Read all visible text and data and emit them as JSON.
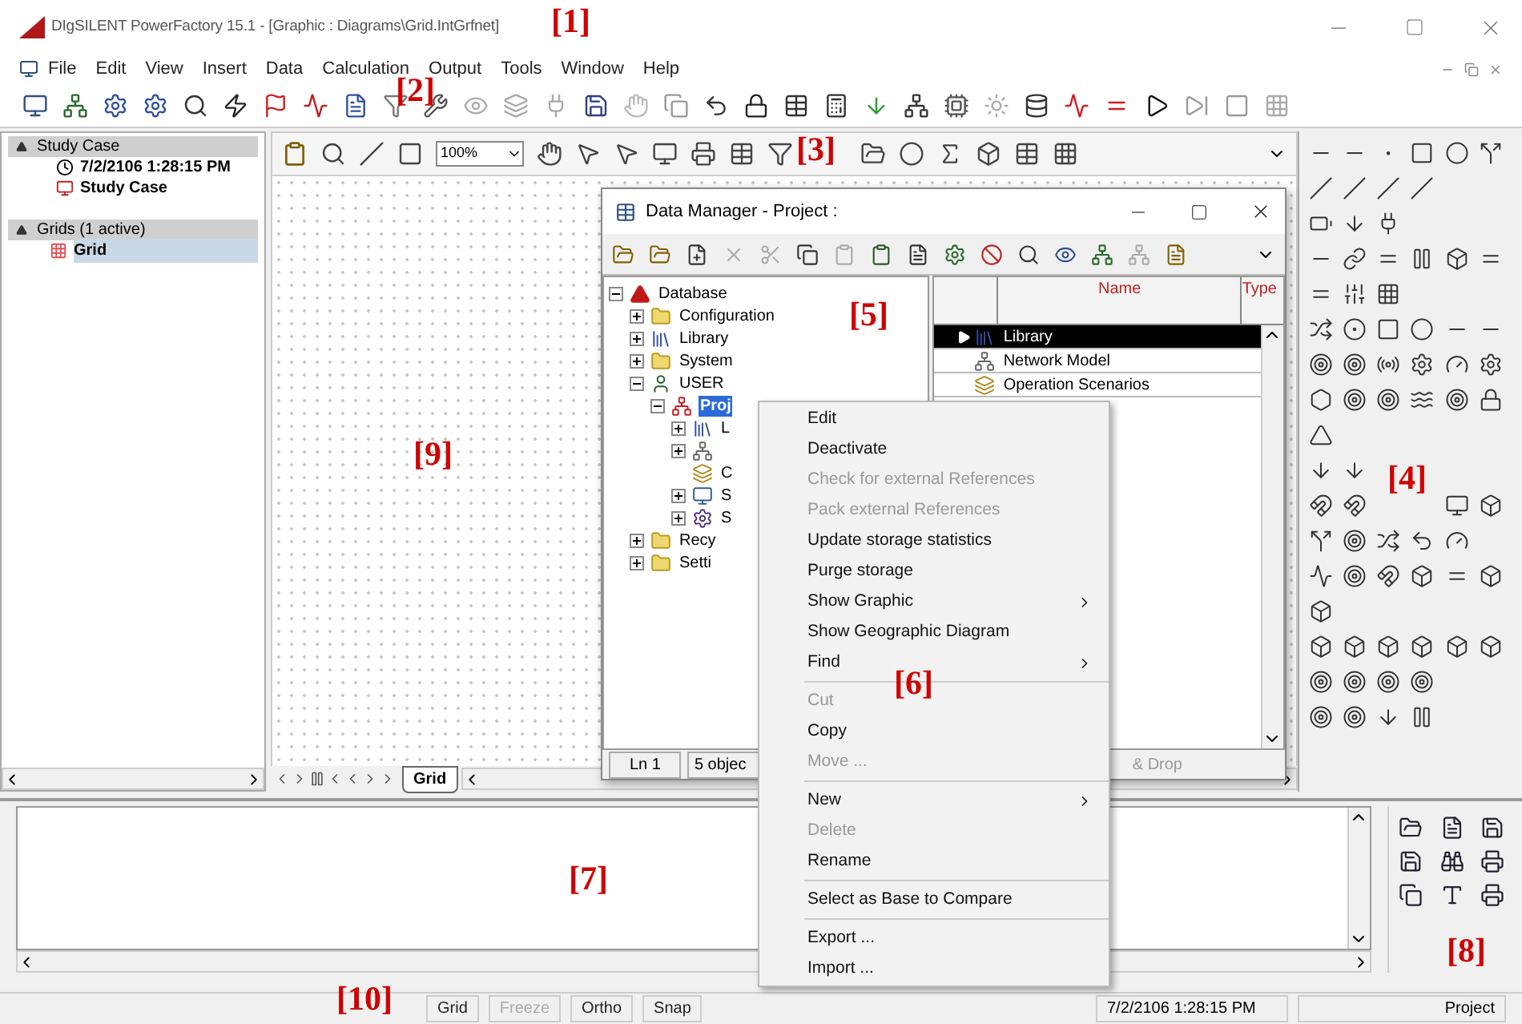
{
  "window": {
    "title": "DIgSILENT PowerFactory 15.1 - [Graphic : Diagrams\\Grid.IntGrfnet]"
  },
  "menu_bar": [
    "File",
    "Edit",
    "View",
    "Insert",
    "Data",
    "Calculation",
    "Output",
    "Tools",
    "Window",
    "Help"
  ],
  "study_case": {
    "header": "Study Case",
    "date": "7/2/2106 1:28:15 PM",
    "name": "Study Case"
  },
  "grids": {
    "header": "Grids (1 active)",
    "items": [
      {
        "label": "Grid",
        "selected": true
      }
    ]
  },
  "graphic": {
    "zoom": "100%",
    "tabs": [
      {
        "label": "Grid",
        "selected": true
      }
    ]
  },
  "data_manager": {
    "title": "Data Manager - Project :",
    "tree": [
      {
        "label": "Database",
        "kind": "database",
        "expanded": true,
        "selected": false,
        "children": [
          {
            "label": "Configuration",
            "kind": "folder",
            "expanded": false,
            "selected": false
          },
          {
            "label": "Library",
            "kind": "library",
            "expanded": false,
            "selected": false
          },
          {
            "label": "System",
            "kind": "folder",
            "expanded": false,
            "selected": false
          },
          {
            "label": "USER",
            "kind": "user",
            "expanded": true,
            "selected": false,
            "children": [
              {
                "label": "Proj",
                "kind": "project",
                "expanded": true,
                "selected": true,
                "children": [
                  {
                    "label": "L",
                    "kind": "library",
                    "expanded": false
                  },
                  {
                    "kind": "network",
                    "expanded": false
                  },
                  {
                    "label": "C",
                    "kind": "scenario"
                  },
                  {
                    "label": "S",
                    "kind": "study",
                    "expanded": false
                  },
                  {
                    "label": "S",
                    "kind": "settings",
                    "expanded": false
                  }
                ]
              }
            ]
          },
          {
            "label": "Recy",
            "kind": "folder",
            "expanded": false,
            "selected": false
          },
          {
            "label": "Setti",
            "kind": "folder",
            "expanded": false,
            "selected": false
          }
        ]
      }
    ],
    "columns": [
      "Name",
      "Type"
    ],
    "rows": [
      {
        "name": "Library",
        "kind": "library",
        "selected": true
      },
      {
        "name": "Network Model",
        "kind": "network",
        "selected": false
      },
      {
        "name": "Operation Scenarios",
        "kind": "scenario",
        "selected": false
      }
    ],
    "status": [
      "Ln 1",
      "5 objec",
      "& Drop"
    ]
  },
  "context_menu": [
    {
      "label": "Edit",
      "disabled": false,
      "submenu": false,
      "separator_after": false
    },
    {
      "label": "Deactivate",
      "disabled": false,
      "submenu": false,
      "separator_after": false
    },
    {
      "label": "Check for external References",
      "disabled": true,
      "submenu": false,
      "separator_after": false
    },
    {
      "label": "Pack external References",
      "disabled": true,
      "submenu": false,
      "separator_after": false
    },
    {
      "label": "Update storage statistics",
      "disabled": false,
      "submenu": false,
      "separator_after": false
    },
    {
      "label": "Purge storage",
      "disabled": false,
      "submenu": false,
      "separator_after": false
    },
    {
      "label": "Show Graphic",
      "disabled": false,
      "submenu": true,
      "separator_after": false
    },
    {
      "label": "Show Geographic Diagram",
      "disabled": false,
      "submenu": false,
      "separator_after": false
    },
    {
      "label": "Find",
      "disabled": false,
      "submenu": true,
      "separator_after": true
    },
    {
      "label": "Cut",
      "disabled": true,
      "submenu": false,
      "separator_after": false
    },
    {
      "label": "Copy",
      "disabled": false,
      "submenu": false,
      "separator_after": false
    },
    {
      "label": "Move ...",
      "disabled": true,
      "submenu": false,
      "separator_after": true
    },
    {
      "label": "New",
      "disabled": false,
      "submenu": true,
      "separator_after": false
    },
    {
      "label": "Delete",
      "disabled": true,
      "submenu": false,
      "separator_after": false
    },
    {
      "label": "Rename",
      "disabled": false,
      "submenu": false,
      "separator_after": true
    },
    {
      "label": "Select as Base to Compare",
      "disabled": false,
      "submenu": false,
      "separator_after": true
    },
    {
      "label": "Export ...",
      "disabled": false,
      "submenu": false,
      "separator_after": false
    },
    {
      "label": "Import ...",
      "disabled": false,
      "submenu": false,
      "separator_after": false
    }
  ],
  "status_bar": {
    "fields": [
      {
        "label": "Grid",
        "disabled": false
      },
      {
        "label": "Freeze",
        "disabled": true
      },
      {
        "label": "Ortho",
        "disabled": false
      },
      {
        "label": "Snap",
        "disabled": false
      }
    ],
    "time": "7/2/2106 1:28:15 PM",
    "project": "Project"
  },
  "annotations": [
    "[1]",
    "[2]",
    "[3]",
    "[4]",
    "[5]",
    "[6]",
    "[7]",
    "[8]",
    "[9]",
    "[10]"
  ]
}
